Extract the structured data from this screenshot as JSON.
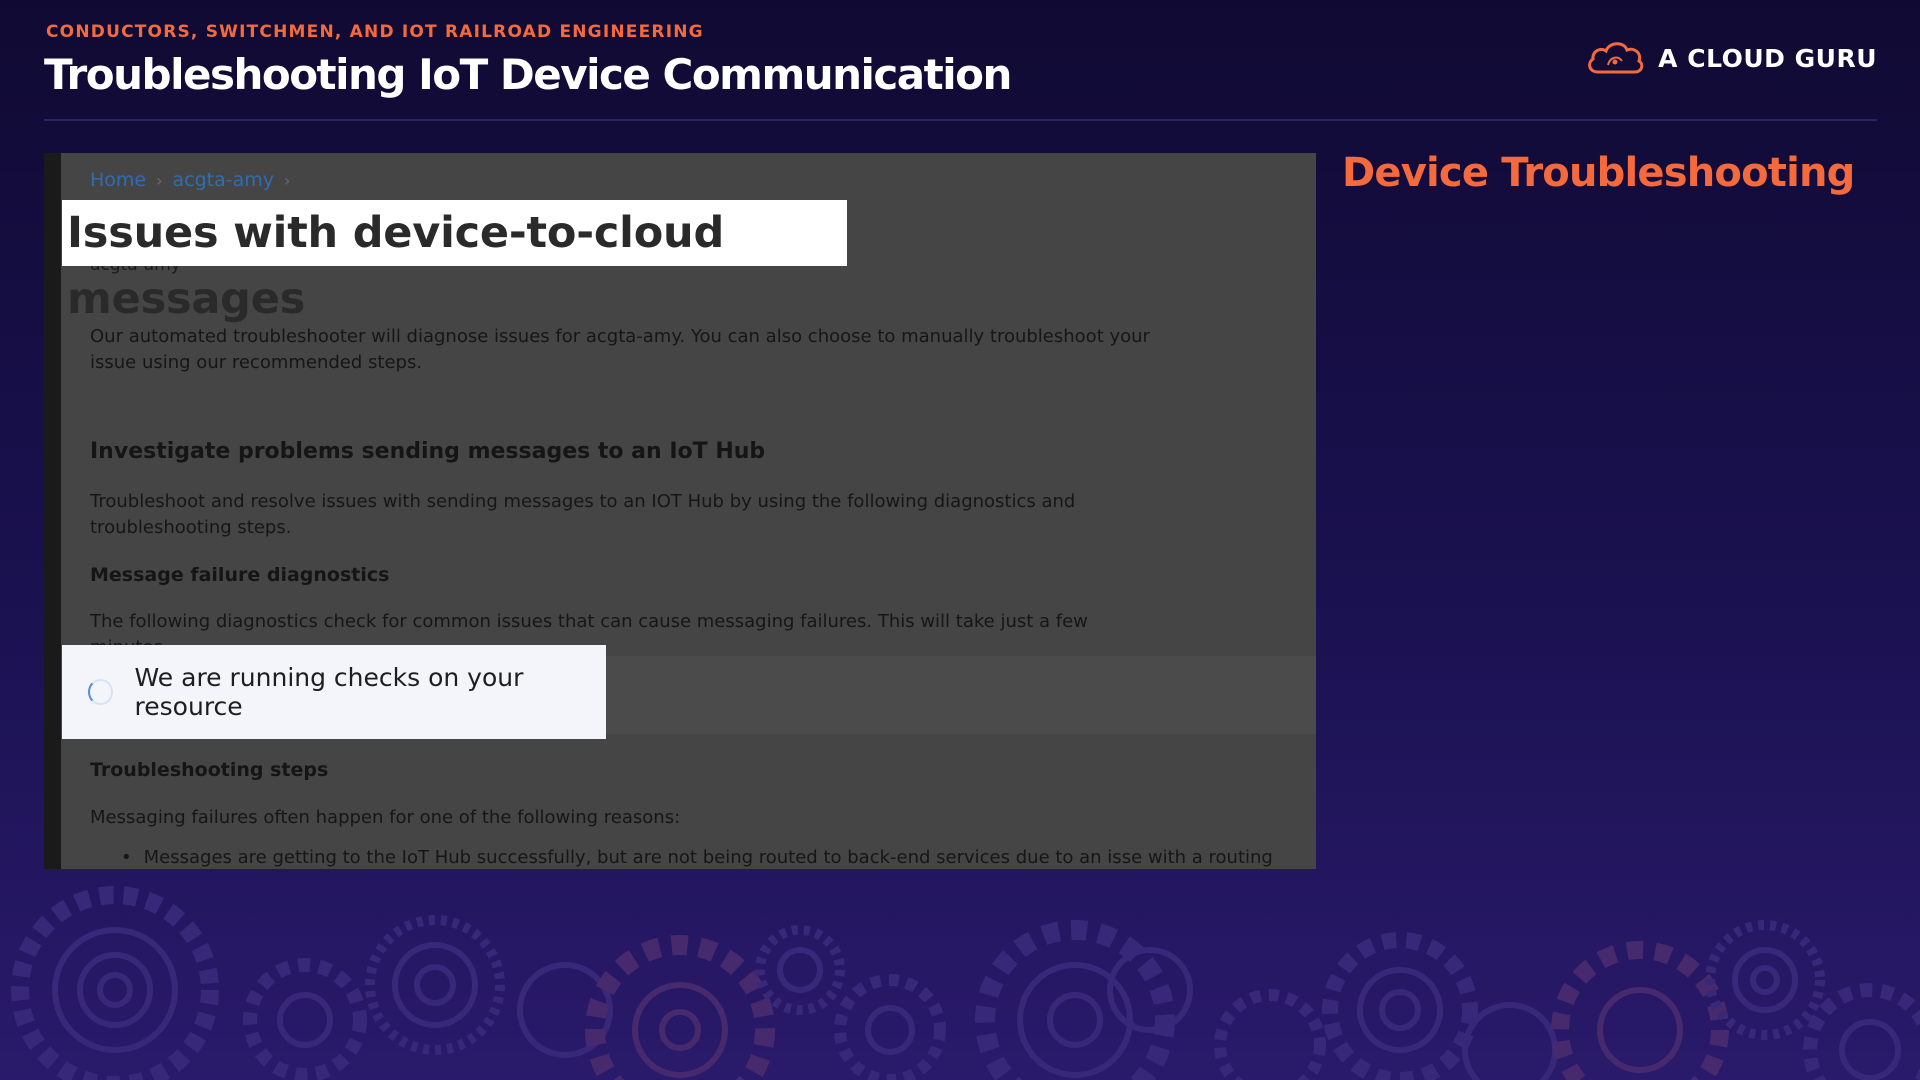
{
  "header": {
    "eyebrow": "CONDUCTORS, SWITCHMEN, AND IOT RAILROAD ENGINEERING",
    "title": "Troubleshooting IoT Device Communication",
    "brand": "A CLOUD GURU",
    "side_heading": "Device Troubleshooting"
  },
  "screenshot": {
    "breadcrumb": [
      "Home",
      "acgta-amy"
    ],
    "highlight_title": "Issues with device-to-cloud messages",
    "subtitle_peek": "acgta-amy",
    "intro": "Our automated troubleshooter will diagnose issues for acgta-amy. You can also choose to manually troubleshoot your issue using our recommended steps.",
    "section_heading": "Investigate problems sending messages to an IoT Hub",
    "section_body": "Troubleshoot and resolve issues with sending messages to an IOT Hub by using the following diagnostics and troubleshooting steps.",
    "diagnostics_heading": "Message failure diagnostics",
    "diagnostics_body": "The following diagnostics check for common issues that can cause messaging failures. This will take just a few minutes.",
    "status": "We are running checks on your resource",
    "steps_heading": "Troubleshooting steps",
    "steps_body": "Messaging failures often happen for one of the following reasons:",
    "bullet_1": "Messages are getting to the IoT Hub successfully, but are not being routed to back-end services due to an isse with a routing"
  },
  "colors": {
    "accent": "#f46a3c",
    "background": "#1a1150"
  }
}
